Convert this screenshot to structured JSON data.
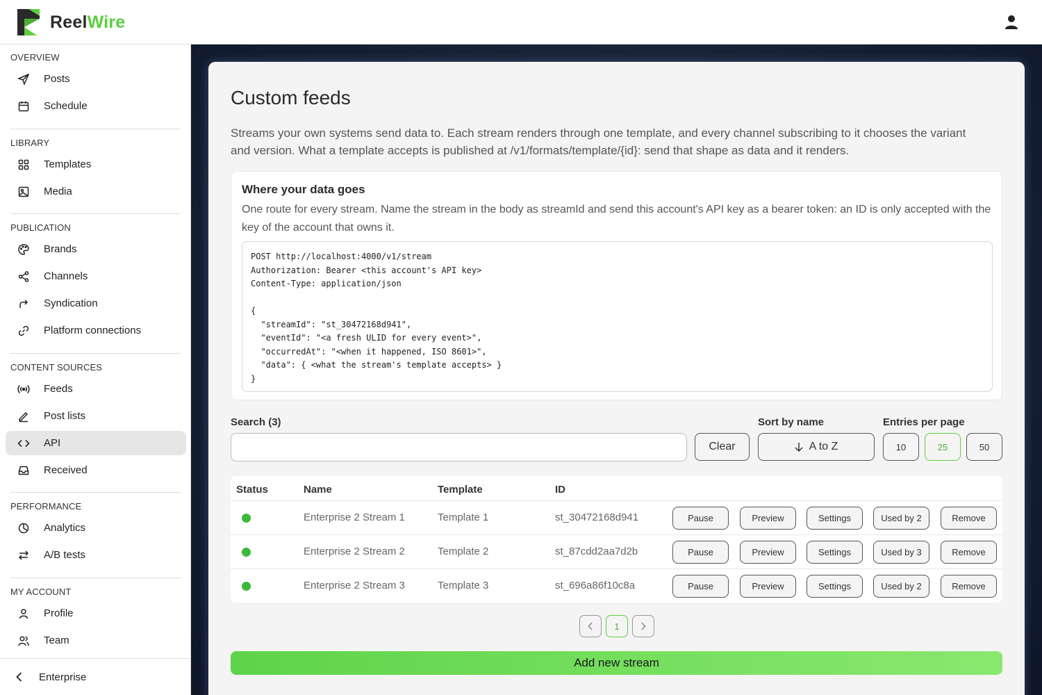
{
  "brand": {
    "name_part1": "Reel",
    "name_part2": "Wire",
    "accent": "#5ccf3e"
  },
  "header": {
    "user_icon": "user-icon"
  },
  "sidebar": {
    "sections": [
      {
        "title": "OVERVIEW",
        "items": [
          {
            "label": "Posts",
            "icon": "send-icon"
          },
          {
            "label": "Schedule",
            "icon": "calendar-icon"
          }
        ]
      },
      {
        "title": "LIBRARY",
        "items": [
          {
            "label": "Templates",
            "icon": "grid-icon"
          },
          {
            "label": "Media",
            "icon": "image-icon"
          }
        ]
      },
      {
        "title": "PUBLICATION",
        "items": [
          {
            "label": "Brands",
            "icon": "palette-icon"
          },
          {
            "label": "Channels",
            "icon": "share-icon"
          },
          {
            "label": "Syndication",
            "icon": "forward-arrow-icon"
          },
          {
            "label": "Platform connections",
            "icon": "link-icon"
          }
        ]
      },
      {
        "title": "CONTENT SOURCES",
        "items": [
          {
            "label": "Feeds",
            "icon": "broadcast-icon"
          },
          {
            "label": "Post lists",
            "icon": "pencil-icon"
          },
          {
            "label": "API",
            "icon": "code-icon",
            "active": true
          },
          {
            "label": "Received",
            "icon": "inbox-icon"
          }
        ]
      },
      {
        "title": "PERFORMANCE",
        "items": [
          {
            "label": "Analytics",
            "icon": "pie-chart-icon"
          },
          {
            "label": "A/B tests",
            "icon": "swap-arrows-icon"
          }
        ]
      },
      {
        "title": "MY ACCOUNT",
        "items": [
          {
            "label": "Profile",
            "icon": "user-icon"
          },
          {
            "label": "Team",
            "icon": "team-icon"
          }
        ]
      }
    ],
    "footer": {
      "label": "Enterprise",
      "icon": "chevron-left-icon"
    }
  },
  "page": {
    "title": "Custom feeds",
    "description": "Streams your own systems send data to. Each stream renders through one template, and every channel subscribing to it chooses the variant and version. What a template accepts is published at /v1/formats/template/{id}: send that shape as data and it renders."
  },
  "info": {
    "title": "Where your data goes",
    "description": "One route for every stream. Name the stream in the body as streamId and send this account's API key as a bearer token: an ID is only accepted with the key of the account that owns it.",
    "code": "POST http://localhost:4000/v1/stream\nAuthorization: Bearer <this account's API key>\nContent-Type: application/json\n\n{\n  \"streamId\": \"st_30472168d941\",\n  \"eventId\": \"<a fresh ULID for every event>\",\n  \"occurredAt\": \"<when it happened, ISO 8601>\",\n  \"data\": { <what the stream's template accepts> }\n}"
  },
  "controls": {
    "search_label": "Search (3)",
    "search_value": "",
    "clear_label": "Clear",
    "sort_label": "Sort by name",
    "sort_value": "A to Z",
    "entries_label": "Entries per page",
    "entries_options": [
      "10",
      "25",
      "50"
    ],
    "entries_selected": "25"
  },
  "table": {
    "headers": [
      "Status",
      "Name",
      "Template",
      "ID"
    ],
    "rows": [
      {
        "status": "active",
        "name": "Enterprise 2 Stream 1",
        "template": "Template 1",
        "id": "st_30472168d941",
        "actions": [
          "Pause",
          "Preview",
          "Settings",
          "Used by 2",
          "Remove"
        ]
      },
      {
        "status": "active",
        "name": "Enterprise 2 Stream 2",
        "template": "Template 2",
        "id": "st_87cdd2aa7d2b",
        "actions": [
          "Pause",
          "Preview",
          "Settings",
          "Used by 3",
          "Remove"
        ]
      },
      {
        "status": "active",
        "name": "Enterprise 2 Stream 3",
        "template": "Template 3",
        "id": "st_696a86f10c8a",
        "actions": [
          "Pause",
          "Preview",
          "Settings",
          "Used by 2",
          "Remove"
        ]
      }
    ]
  },
  "pagination": {
    "current": "1",
    "prev_icon": "chevron-left-icon",
    "next_icon": "chevron-right-icon"
  },
  "add_button_label": "Add new stream",
  "colors": {
    "status_active": "#3eb83a",
    "sidebar_active_bg": "#e6e6e6",
    "main_bg": "#172136"
  }
}
